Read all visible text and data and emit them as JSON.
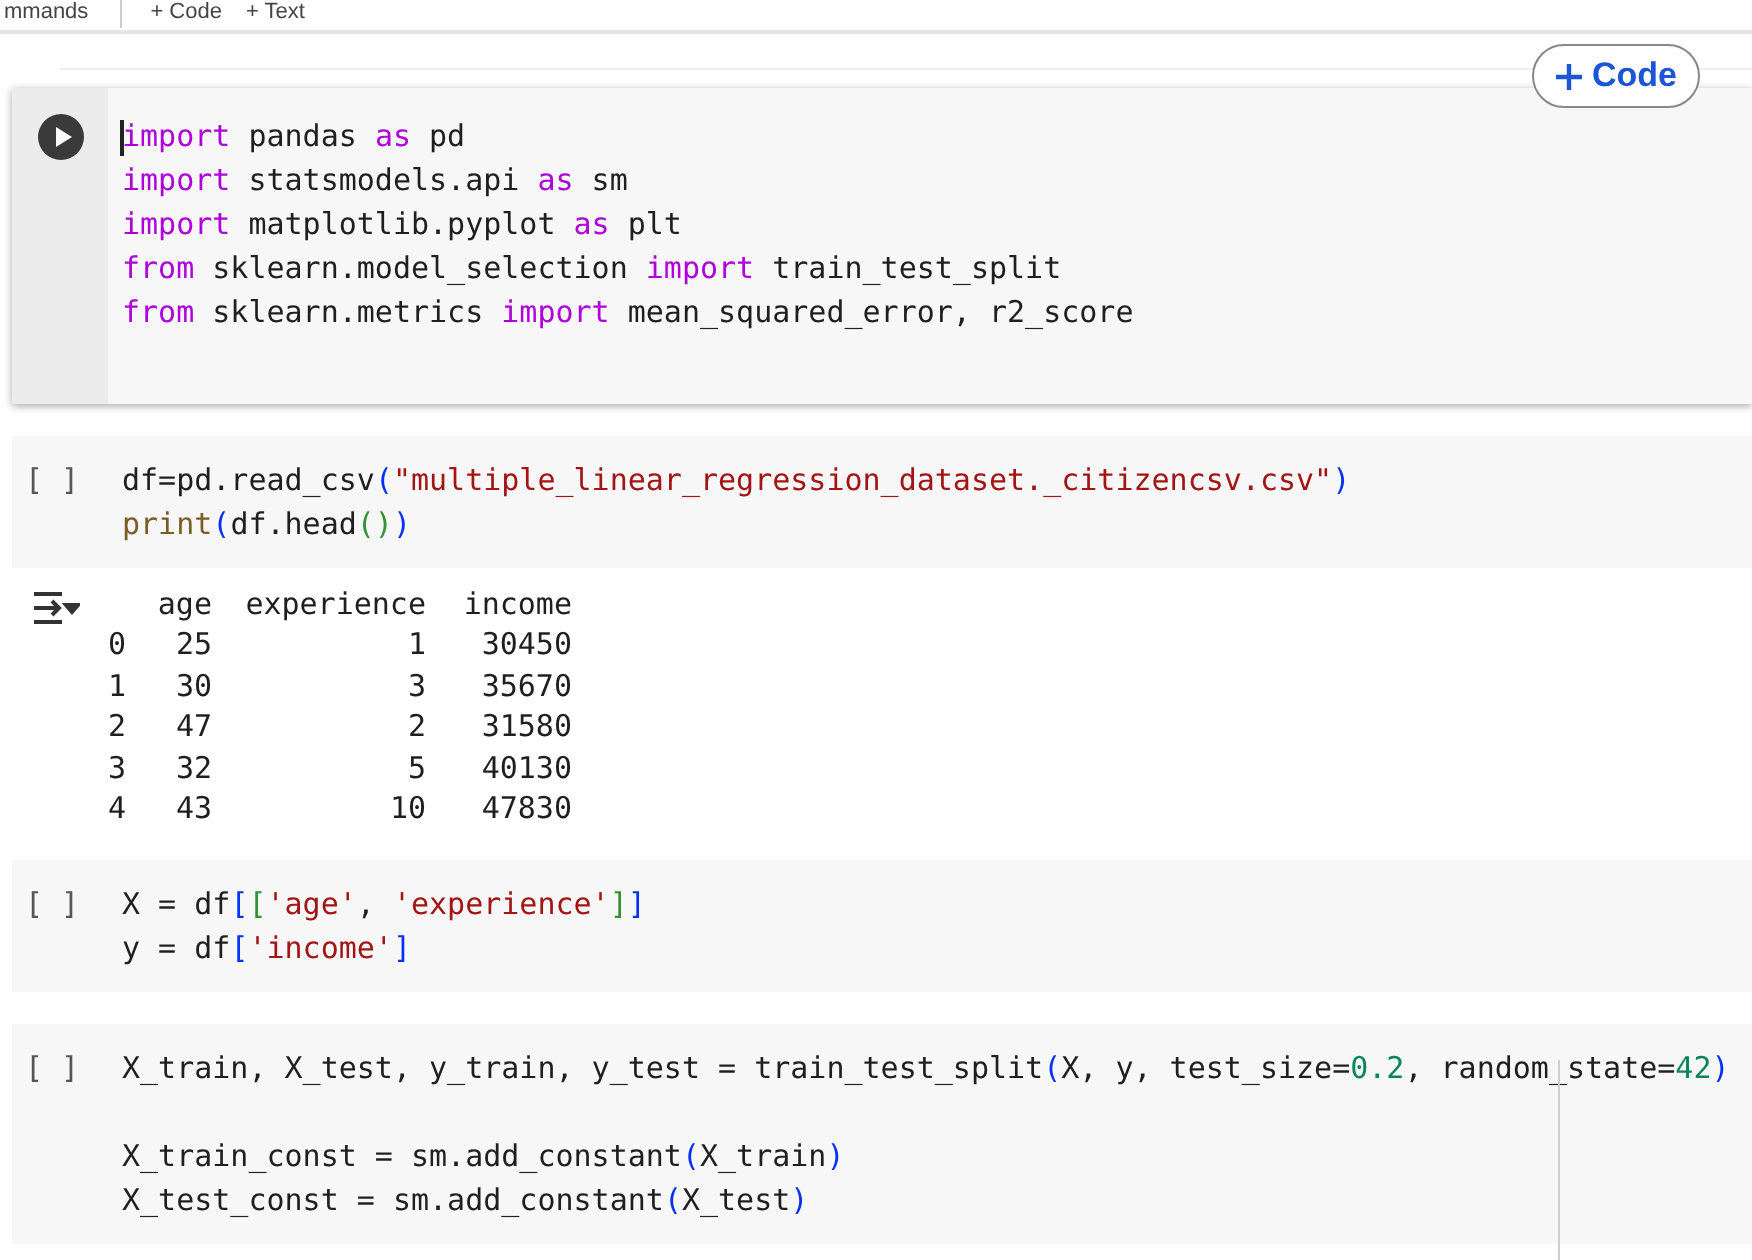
{
  "toolbar": {
    "items": [
      "mmands",
      "+ Code",
      "+ Text"
    ]
  },
  "add_code_button": {
    "label": "Code"
  },
  "cells": [
    {
      "focused": true,
      "blocks": [
        [
          [
            {
              "text": "import",
              "kind": "keyword"
            },
            {
              "text": " pandas ",
              "kind": "plain"
            },
            {
              "text": "as",
              "kind": "keyword"
            },
            {
              "text": " pd",
              "kind": "plain"
            }
          ],
          [
            {
              "text": "import",
              "kind": "keyword"
            },
            {
              "text": " statsmodels.api ",
              "kind": "plain"
            },
            {
              "text": "as",
              "kind": "keyword"
            },
            {
              "text": " sm",
              "kind": "plain"
            }
          ],
          [
            {
              "text": "import",
              "kind": "keyword"
            },
            {
              "text": " matplotlib.pyplot ",
              "kind": "plain"
            },
            {
              "text": "as",
              "kind": "keyword"
            },
            {
              "text": " plt",
              "kind": "plain"
            }
          ],
          [
            {
              "text": "from",
              "kind": "keyword"
            },
            {
              "text": " sklearn.model_selection ",
              "kind": "plain"
            },
            {
              "text": "import",
              "kind": "keyword"
            },
            {
              "text": " train_test_split",
              "kind": "plain"
            }
          ],
          [
            {
              "text": "from",
              "kind": "keyword"
            },
            {
              "text": " sklearn.metrics ",
              "kind": "plain"
            },
            {
              "text": "import",
              "kind": "keyword"
            },
            {
              "text": " mean_squared_error, r2_score",
              "kind": "plain"
            }
          ]
        ]
      ]
    },
    {
      "focused": false,
      "prompt": "[ ]",
      "blocks": [
        [
          [
            {
              "text": "df=pd.read_csv",
              "kind": "plain"
            },
            {
              "text": "(",
              "kind": "bracket1"
            },
            {
              "text": "\"multiple_linear_regression_dataset._citizencsv.csv\"",
              "kind": "string"
            },
            {
              "text": ")",
              "kind": "bracket1"
            }
          ],
          [
            {
              "text": "print",
              "kind": "builtin"
            },
            {
              "text": "(",
              "kind": "bracket1"
            },
            {
              "text": "df.head",
              "kind": "plain"
            },
            {
              "text": "()",
              "kind": "bracket2"
            },
            {
              "text": ")",
              "kind": "bracket1"
            }
          ]
        ]
      ],
      "output": {
        "columns": [
          "age",
          "experience",
          "income"
        ],
        "rows": [
          {
            "index": "0",
            "cells": [
              "25",
              "1",
              "30450"
            ]
          },
          {
            "index": "1",
            "cells": [
              "30",
              "3",
              "35670"
            ]
          },
          {
            "index": "2",
            "cells": [
              "47",
              "2",
              "31580"
            ]
          },
          {
            "index": "3",
            "cells": [
              "32",
              "5",
              "40130"
            ]
          },
          {
            "index": "4",
            "cells": [
              "43",
              "10",
              "47830"
            ]
          }
        ]
      }
    },
    {
      "focused": false,
      "prompt": "[ ]",
      "blocks": [
        [
          [
            {
              "text": "X = df",
              "kind": "plain"
            },
            {
              "text": "[",
              "kind": "bracket1"
            },
            {
              "text": "[",
              "kind": "bracket2"
            },
            {
              "text": "'age'",
              "kind": "string"
            },
            {
              "text": ", ",
              "kind": "plain"
            },
            {
              "text": "'experience'",
              "kind": "string"
            },
            {
              "text": "]",
              "kind": "bracket2"
            },
            {
              "text": "]",
              "kind": "bracket1"
            }
          ],
          [
            {
              "text": "y = df",
              "kind": "plain"
            },
            {
              "text": "[",
              "kind": "bracket1"
            },
            {
              "text": "'income'",
              "kind": "string"
            },
            {
              "text": "]",
              "kind": "bracket1"
            }
          ]
        ]
      ]
    },
    {
      "focused": false,
      "prompt": "[ ]",
      "blocks": [
        [
          [
            {
              "text": "X_train, X_test, y_train, y_test = train_test_split",
              "kind": "plain"
            },
            {
              "text": "(",
              "kind": "bracket1"
            },
            {
              "text": "X, y, test_size=",
              "kind": "plain"
            },
            {
              "text": "0.2",
              "kind": "number"
            },
            {
              "text": ", random_state=",
              "kind": "plain"
            },
            {
              "text": "42",
              "kind": "number"
            },
            {
              "text": ")",
              "kind": "bracket1"
            }
          ]
        ],
        [
          [
            {
              "text": "X_train_const = sm.add_constant",
              "kind": "plain"
            },
            {
              "text": "(",
              "kind": "bracket1"
            },
            {
              "text": "X_train",
              "kind": "plain"
            },
            {
              "text": ")",
              "kind": "bracket1"
            }
          ],
          [
            {
              "text": "X_test_const = sm.add_constant",
              "kind": "plain"
            },
            {
              "text": "(",
              "kind": "bracket1"
            },
            {
              "text": "X_test",
              "kind": "plain"
            },
            {
              "text": ")",
              "kind": "bracket1"
            }
          ]
        ]
      ]
    }
  ]
}
